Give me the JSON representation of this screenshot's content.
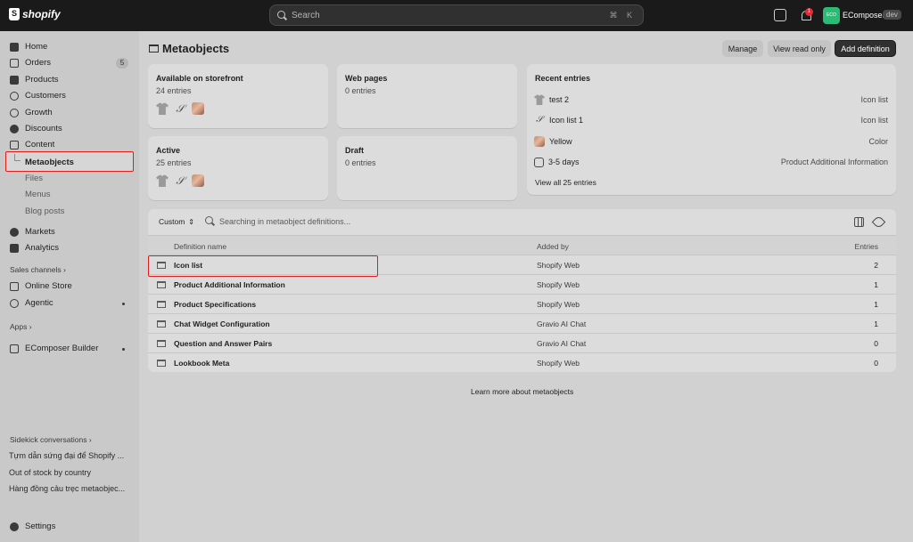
{
  "topbar": {
    "brand": "shopify",
    "search_placeholder": "Search",
    "search_shortcut": "⌘ K",
    "notification_count": "1",
    "avatar_initials": "ECO",
    "store_name": "EComposer",
    "store_badge": "dev"
  },
  "sidebar": {
    "items": [
      {
        "label": "Home"
      },
      {
        "label": "Orders",
        "badge": "5"
      },
      {
        "label": "Products"
      },
      {
        "label": "Customers"
      },
      {
        "label": "Growth"
      },
      {
        "label": "Discounts"
      },
      {
        "label": "Content"
      }
    ],
    "content_sub": [
      "Metaobjects",
      "Files",
      "Menus",
      "Blog posts"
    ],
    "more_items": [
      {
        "label": "Markets"
      },
      {
        "label": "Analytics"
      }
    ],
    "sales_channels_label": "Sales channels",
    "sales_channels": [
      {
        "label": "Online Store"
      },
      {
        "label": "Agentic"
      }
    ],
    "apps_label": "Apps",
    "apps": [
      {
        "label": "EComposer Builder"
      }
    ],
    "sidekick_label": "Sidekick conversations",
    "sidekick": [
      "Tựm dẫn sứng đại để Shopify ...",
      "Out of stock by country",
      "Hàng đồng cảu trẹc metaobjec..."
    ],
    "settings_label": "Settings"
  },
  "page": {
    "title": "Metaobjects",
    "buttons": {
      "manage": "Manage",
      "view_read_only": "View read only",
      "add_definition": "Add definition"
    }
  },
  "stats": {
    "storefront": {
      "title": "Available on storefront",
      "sub": "24 entries"
    },
    "web_pages": {
      "title": "Web pages",
      "sub": "0 entries"
    },
    "active": {
      "title": "Active",
      "sub": "25 entries"
    },
    "draft": {
      "title": "Draft",
      "sub": "0 entries"
    }
  },
  "recent": {
    "title": "Recent entries",
    "entries": [
      {
        "name": "test 2",
        "type": "Icon list"
      },
      {
        "name": "Icon list 1",
        "type": "Icon list"
      },
      {
        "name": "Yellow",
        "type": "Color"
      },
      {
        "name": "3-5 days",
        "type": "Product Additional Information"
      }
    ],
    "view_all": "View all 25 entries"
  },
  "table": {
    "filter_label": "Custom",
    "search_placeholder": "Searching in metaobject definitions...",
    "columns": {
      "name": "Definition name",
      "added_by": "Added by",
      "entries": "Entries"
    },
    "rows": [
      {
        "name": "Icon list",
        "added_by": "Shopify Web",
        "entries": "2"
      },
      {
        "name": "Product Additional Information",
        "added_by": "Shopify Web",
        "entries": "1"
      },
      {
        "name": "Product Specifications",
        "added_by": "Shopify Web",
        "entries": "1"
      },
      {
        "name": "Chat Widget Configuration",
        "added_by": "Gravio AI Chat",
        "entries": "1"
      },
      {
        "name": "Question and Answer Pairs",
        "added_by": "Gravio AI Chat",
        "entries": "0"
      },
      {
        "name": "Lookbook Meta",
        "added_by": "Shopify Web",
        "entries": "0"
      }
    ]
  },
  "footer": {
    "learn_more": "Learn more about metaobjects"
  },
  "colors": {
    "highlight": "#e01e1e",
    "avatar": "#2dba75",
    "topbar": "#1a1a1a"
  }
}
